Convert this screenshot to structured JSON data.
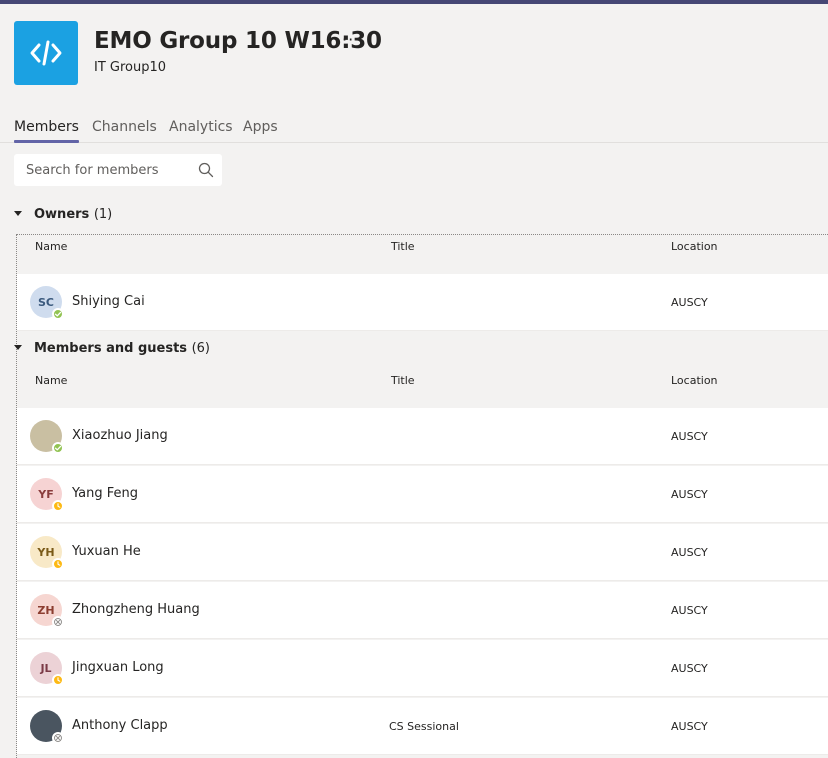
{
  "header": {
    "team_name": "EMO Group 10 W16:30",
    "more_label": "···",
    "team_subtitle": "IT Group10",
    "logo_icon": "code-icon",
    "logo_color": "#1ba1e2"
  },
  "tabs": [
    {
      "label": "Members",
      "active": true
    },
    {
      "label": "Channels",
      "active": false
    },
    {
      "label": "Analytics",
      "active": false
    },
    {
      "label": "Apps",
      "active": false
    }
  ],
  "search": {
    "placeholder": "Search for members",
    "value": ""
  },
  "columns": {
    "name": "Name",
    "title": "Title",
    "location": "Location"
  },
  "owners": {
    "label": "Owners",
    "count": "(1)",
    "members": [
      {
        "initials": "SC",
        "name": "Shiying Cai",
        "title": "",
        "location": "AUSCY",
        "status": "available",
        "avatar_color": "#cfdcee",
        "avatar_text_color": "#3b5a7e"
      }
    ]
  },
  "members_guests": {
    "label": "Members and guests",
    "count": "(6)",
    "members": [
      {
        "initials": "",
        "name": "Xiaozhuo Jiang",
        "title": "",
        "location": "AUSCY",
        "status": "available",
        "avatar_color": "#c9bfa2",
        "avatar_text_color": "#5c5236"
      },
      {
        "initials": "YF",
        "name": "Yang Feng",
        "title": "",
        "location": "AUSCY",
        "status": "away",
        "avatar_color": "#f6d3d3",
        "avatar_text_color": "#8a3c3c"
      },
      {
        "initials": "YH",
        "name": "Yuxuan He",
        "title": "",
        "location": "AUSCY",
        "status": "away",
        "avatar_color": "#f8e9c7",
        "avatar_text_color": "#7a5a17"
      },
      {
        "initials": "ZH",
        "name": "Zhongzheng Huang",
        "title": "",
        "location": "AUSCY",
        "status": "offline",
        "avatar_color": "#f6d6d1",
        "avatar_text_color": "#8c3d30"
      },
      {
        "initials": "JL",
        "name": "Jingxuan Long",
        "title": "",
        "location": "AUSCY",
        "status": "away",
        "avatar_color": "#ecd2d6",
        "avatar_text_color": "#7b3a46"
      },
      {
        "initials": "",
        "name": "Anthony Clapp",
        "title": "CS Sessional",
        "location": "AUSCY",
        "status": "offline",
        "avatar_color": "#4a5560",
        "avatar_text_color": "#ffffff"
      }
    ]
  }
}
